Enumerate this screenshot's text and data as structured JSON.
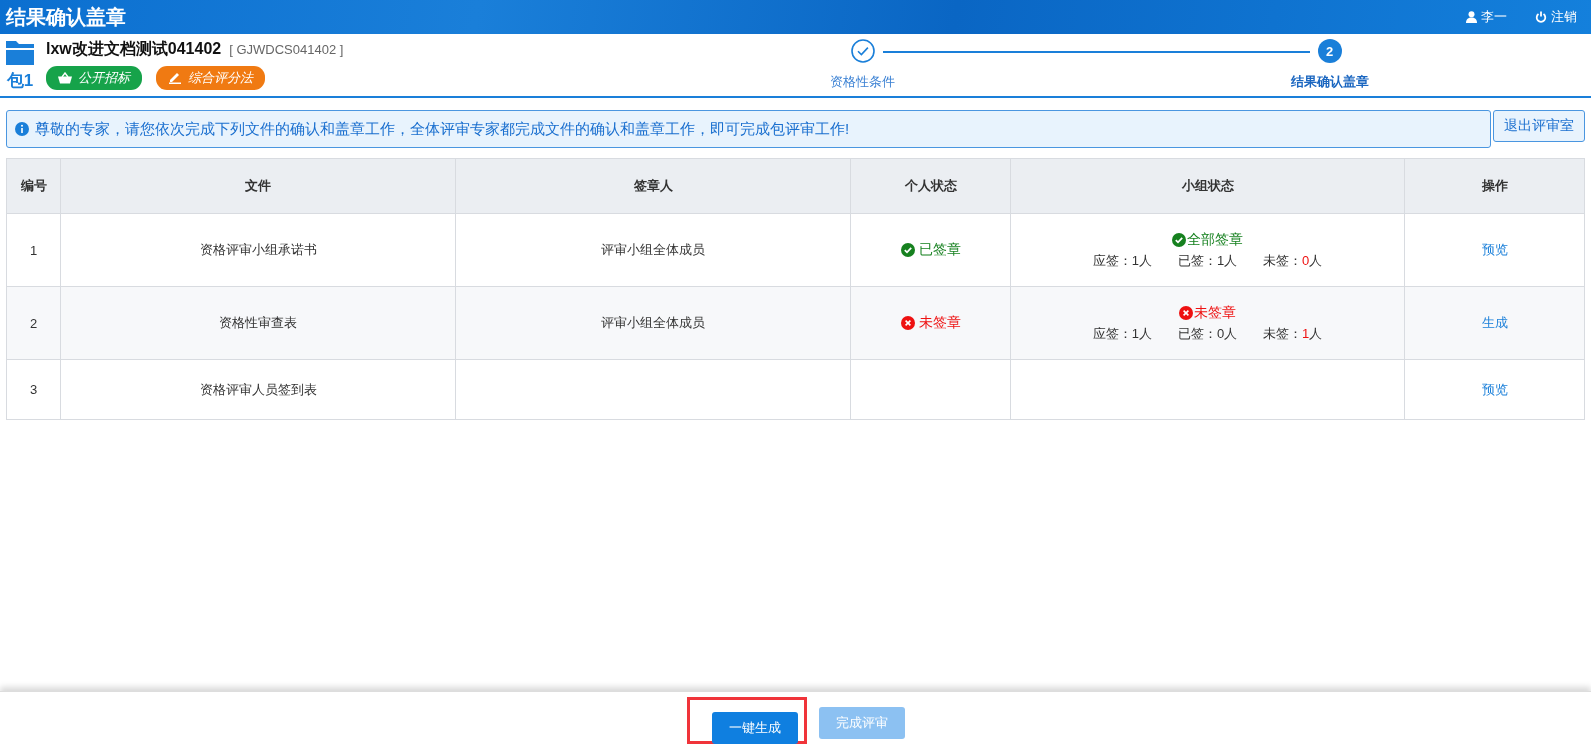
{
  "header": {
    "title": "结果确认盖章",
    "user": "李一",
    "logout": "注销"
  },
  "project": {
    "name": "lxw改进文档测试041402",
    "code": "[ GJWDCS041402 ]",
    "package": "包1",
    "tags": [
      {
        "kind": "tender",
        "label": "公开招标",
        "color": "#16a34a"
      },
      {
        "kind": "scoring",
        "label": "综合评分法",
        "color": "#f07a12"
      }
    ]
  },
  "steps": [
    {
      "label": "资格性条件",
      "completed": true,
      "selected": false
    },
    {
      "label": "结果确认盖章",
      "number": "2",
      "completed": false,
      "selected": true
    }
  ],
  "notice": {
    "text": "尊敬的专家，请您依次完成下列文件的确认和盖章工作，全体评审专家都完成文件的确认和盖章工作，即可完成包评审工作!",
    "exit_button": "退出评审室"
  },
  "table": {
    "columns": [
      "编号",
      "文件",
      "签章人",
      "个人状态",
      "小组状态",
      "操作"
    ],
    "rows": [
      {
        "no": "1",
        "file": "资格评审小组承诺书",
        "signer": "评审小组全体成员",
        "personal": {
          "kind": "signed",
          "label": "已签章"
        },
        "group": {
          "kind": "signed",
          "label": "全部签章",
          "stats": [
            {
              "label": "应签：",
              "number": "1",
              "unit": "人",
              "emphasized": false
            },
            {
              "label": "已签：",
              "number": "1",
              "unit": "人",
              "emphasized": false
            },
            {
              "label": "未签：",
              "number": "0",
              "unit": "人",
              "emphasized": true
            }
          ]
        },
        "action": "预览"
      },
      {
        "no": "2",
        "file": "资格性审查表",
        "signer": "评审小组全体成员",
        "personal": {
          "kind": "unsigned",
          "label": "未签章"
        },
        "group": {
          "kind": "unsigned",
          "label": "未签章",
          "stats": [
            {
              "label": "应签：",
              "number": "1",
              "unit": "人",
              "emphasized": false
            },
            {
              "label": "已签：",
              "number": "0",
              "unit": "人",
              "emphasized": false
            },
            {
              "label": "未签：",
              "number": "1",
              "unit": "人",
              "emphasized": true
            }
          ]
        },
        "action": "生成"
      },
      {
        "no": "3",
        "file": "资格评审人员签到表",
        "action": "预览"
      }
    ]
  },
  "footer": {
    "buttons": [
      {
        "label": "一键生成",
        "disabled": false,
        "highlighted": true
      },
      {
        "label": "完成评审",
        "disabled": true,
        "highlighted": false
      }
    ]
  }
}
